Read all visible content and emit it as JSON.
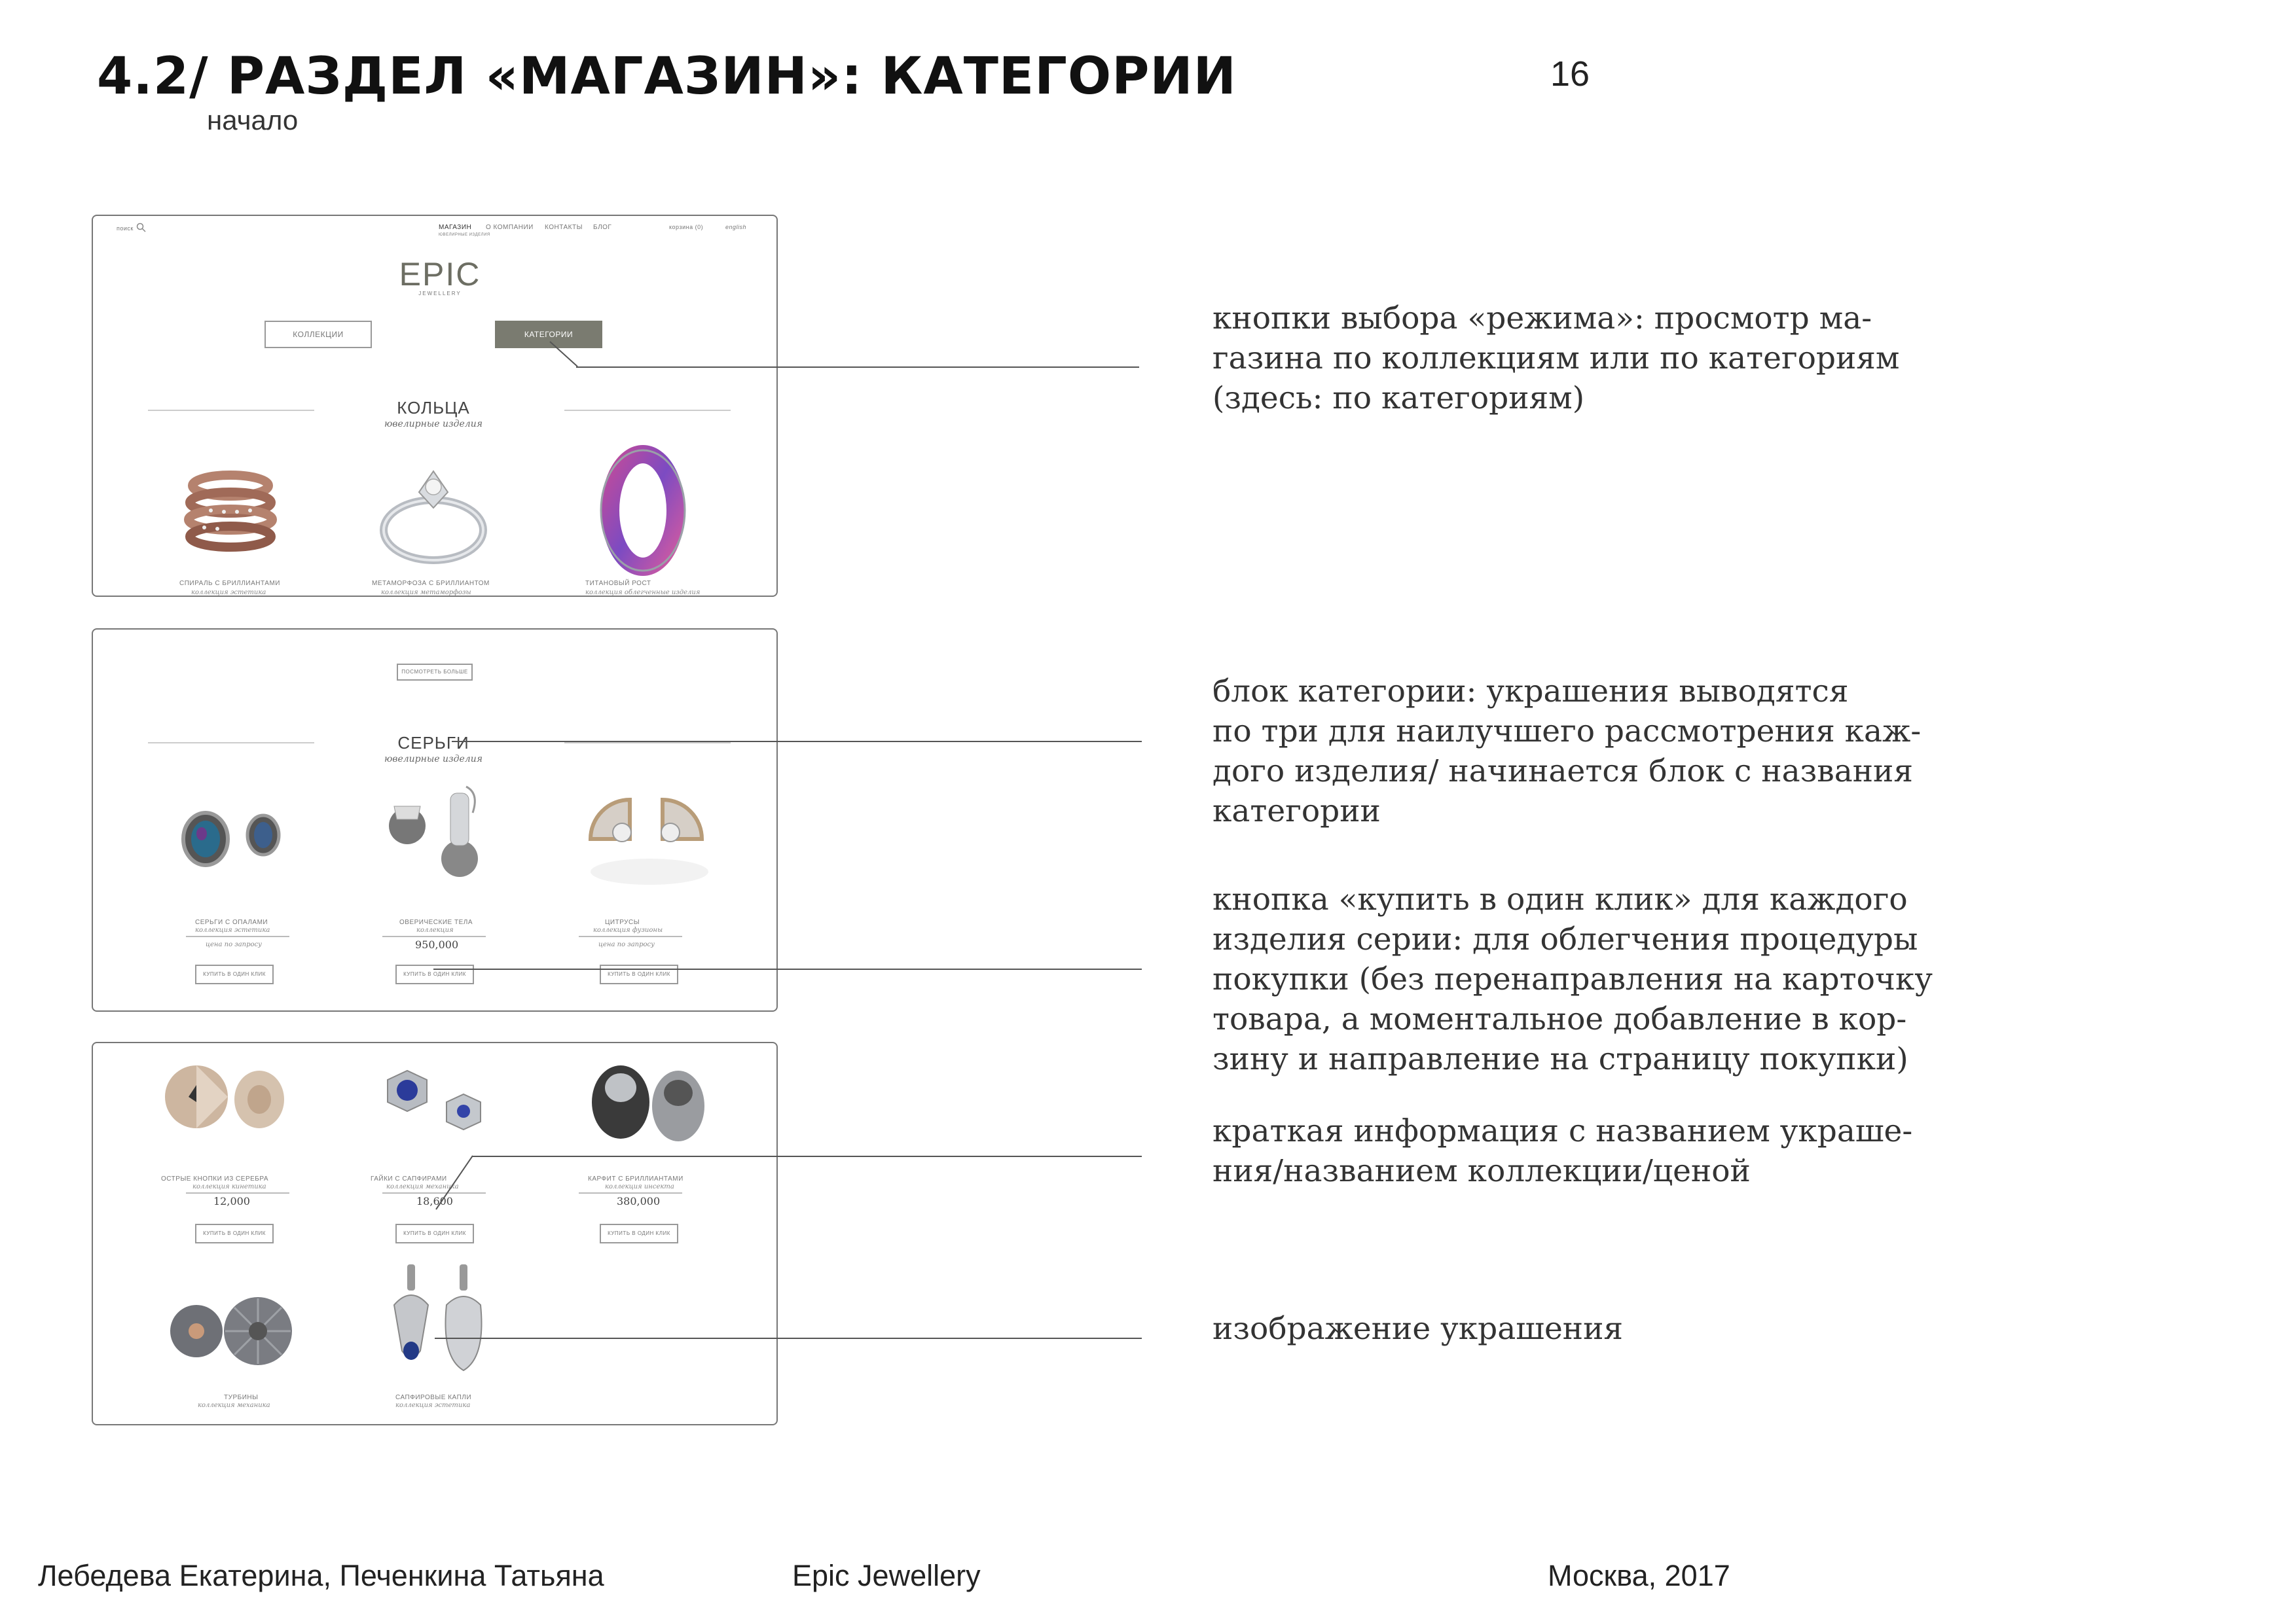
{
  "header": {
    "title": "4.2/ РАЗДЕЛ «МАГАЗИН»: КАТЕГОРИИ",
    "subtitle": "начало",
    "page_number": "16"
  },
  "annotations": [
    [
      "кнопки выбора «режима»: просмотр ма-",
      "газина по коллекциям или по категориям",
      "(здесь: по категориям)"
    ],
    [
      "блок категории: украшения выводятся",
      "по три для наилучшего рассмотрения каж-",
      "дого изделия/ начинается блок с названия",
      "категории"
    ],
    [
      "кнопка «купить в один клик» для каждого",
      "изделия серии: для облегчения процедуры",
      "покупки (без перенаправления на карточку",
      "товара, а моментальное добавление в кор-",
      "зину и направление на страницу покупки)"
    ],
    [
      "краткая информация с названием украше-",
      "ния/названием коллекции/ценой"
    ],
    [
      "изображение украшения"
    ]
  ],
  "footer": {
    "authors": "Лебедева Екатерина, Печенкина Татьяна",
    "project": "Epic Jewellery",
    "place_date": "Москва, 2017"
  },
  "mockup1": {
    "search_label": "поиск",
    "nav": [
      "МАГАЗИН",
      "О КОМПАНИИ",
      "КОНТАКТЫ",
      "БЛОГ"
    ],
    "nav_sub": "ЮВЕЛИРНЫЕ ИЗДЕЛИЯ",
    "cart_label": "корзина (0)",
    "lang_label": "english",
    "logo": "EPIC",
    "logo_sub": "JEWELLERY",
    "mode_buttons": [
      "КОЛЛЕКЦИИ",
      "КАТЕГОРИИ"
    ],
    "category_title": "КОЛЬЦА",
    "category_sub": "ювелирные изделия",
    "products": [
      {
        "name": "СПИРАЛЬ С БРИЛЛИАНТАМИ",
        "collection": "коллекция эстетика"
      },
      {
        "name": "МЕТАМОРФОЗА С БРИЛЛИАНТОМ",
        "collection": "коллекция метаморфозы"
      },
      {
        "name": "ТИТАНОВЫЙ РОСТ",
        "collection": "коллекция облегченные изделия"
      }
    ]
  },
  "mockup2": {
    "show_more": "ПОСМОТРЕТЬ БОЛЬШЕ",
    "category_title": "СЕРЬГИ",
    "category_sub": "ювелирные изделия",
    "products": [
      {
        "name": "СЕРЬГИ С ОПАЛАМИ",
        "collection": "коллекция эстетика",
        "price": "цена по запросу",
        "button": "КУПИТЬ В ОДИН КЛИК"
      },
      {
        "name": "ОВЕРИЧЕСКИЕ ТЕЛА",
        "collection": "коллекция",
        "price": "950,000",
        "button": "КУПИТЬ В ОДИН КЛИК"
      },
      {
        "name": "ЦИТРУСЫ",
        "collection": "коллекция фузионы",
        "price": "цена по запросу",
        "button": "КУПИТЬ В ОДИН КЛИК"
      }
    ]
  },
  "mockup3": {
    "products": [
      {
        "name": "ОСТРЫЕ КНОПКИ ИЗ СЕРЕБРА",
        "collection": "коллекция кинетика",
        "price": "12,000",
        "button": "КУПИТЬ В ОДИН КЛИК"
      },
      {
        "name": "ГАЙКИ С САПФИРАМИ",
        "collection": "коллекция механика",
        "price": "18,600",
        "button": "КУПИТЬ В ОДИН КЛИК"
      },
      {
        "name": "КАРФИТ С БРИЛЛИАНТАМИ",
        "collection": "коллекция инсекта",
        "price": "380,000",
        "button": "КУПИТЬ В ОДИН КЛИК"
      },
      {
        "name": "ТУРБИНЫ",
        "collection": "коллекция механика"
      },
      {
        "name": "САПФИРОВЫЕ КАПЛИ",
        "collection": "коллекция эстетика"
      }
    ]
  },
  "colors": {
    "active_button": "#7a7b70",
    "leader": "#555555",
    "frame": "#777777"
  }
}
